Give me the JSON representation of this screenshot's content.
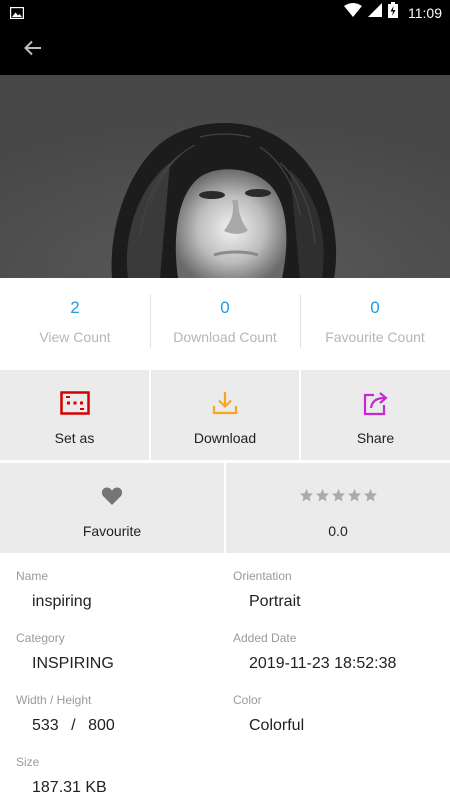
{
  "status_bar": {
    "time": "11:09",
    "icons": [
      "image-notification-icon",
      "wifi-icon",
      "signal-icon",
      "battery-charging-icon"
    ]
  },
  "toolbar": {
    "back_icon": "arrow-back-icon"
  },
  "stats": [
    {
      "value": "2",
      "label": "View Count"
    },
    {
      "value": "0",
      "label": "Download Count"
    },
    {
      "value": "0",
      "label": "Favourite Count"
    }
  ],
  "actions": {
    "set_as": {
      "label": "Set as",
      "icon": "wallpaper-icon",
      "color": "#d50000"
    },
    "download": {
      "label": "Download",
      "icon": "download-icon",
      "color": "#f5a623"
    },
    "share": {
      "label": "Share",
      "icon": "share-icon",
      "color": "#c62ad0"
    },
    "favourite": {
      "label": "Favourite",
      "icon": "heart-icon",
      "color": "#757575"
    },
    "rating": {
      "value": "0.0",
      "stars": 0,
      "max_stars": 5
    }
  },
  "details": {
    "name": {
      "label": "Name",
      "value": "inspiring"
    },
    "orientation": {
      "label": "Orientation",
      "value": "Portrait"
    },
    "category": {
      "label": "Category",
      "value": "INSPIRING"
    },
    "added_date": {
      "label": "Added Date",
      "value": "2019-11-23 18:52:38"
    },
    "width_height": {
      "label": "Width / Height",
      "width": "533",
      "separator": "/",
      "height": "800"
    },
    "color": {
      "label": "Color",
      "value": "Colorful"
    },
    "size": {
      "label": "Size",
      "value": "187.31 KB"
    }
  }
}
